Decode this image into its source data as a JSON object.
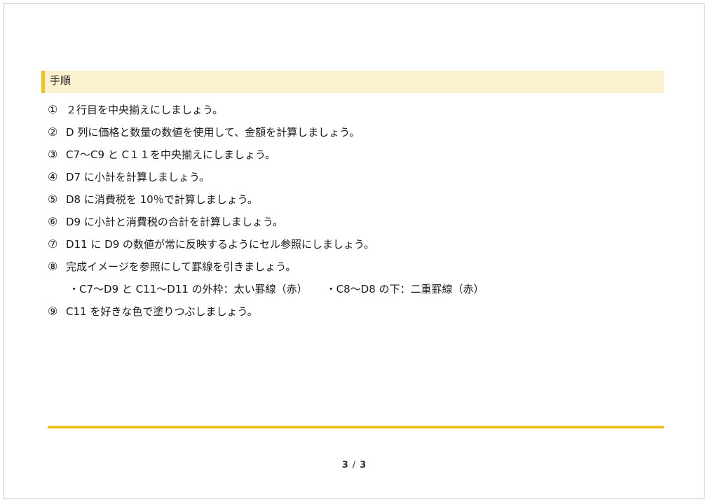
{
  "section": {
    "title": "手順"
  },
  "steps": [
    {
      "num": "①",
      "text": "２行目を中央揃えにしましょう。"
    },
    {
      "num": "②",
      "text": "D 列に価格と数量の数値を使用して、金額を計算しましょう。"
    },
    {
      "num": "③",
      "text": "C7～C9 と C１１を中央揃えにしましょう。"
    },
    {
      "num": "④",
      "text": "D7 に小計を計算しましょう。"
    },
    {
      "num": "⑤",
      "text": "D8 に消費税を 10％で計算しましょう。"
    },
    {
      "num": "⑥",
      "text": "D9 に小計と消費税の合計を計算しましょう。"
    },
    {
      "num": "⑦",
      "text": "D11 に D9 の数値が常に反映するようにセル参照にしましょう。"
    },
    {
      "num": "⑧",
      "text": "完成イメージを参照にして罫線を引きましょう。"
    },
    {
      "num": "⑨",
      "text": "C11 を好きな色で塗りつぶしましょう。"
    }
  ],
  "step8_sub": {
    "item1": "・C7～D9 と C11～D11 の外枠：太い罫線（赤）",
    "item2": "・C8～D8 の下：二重罫線（赤）"
  },
  "footer": {
    "current_page": "3",
    "separator": "/",
    "total_pages": "3"
  },
  "colors": {
    "accent": "#f3c11b",
    "header_bg": "#fdf2d0"
  }
}
